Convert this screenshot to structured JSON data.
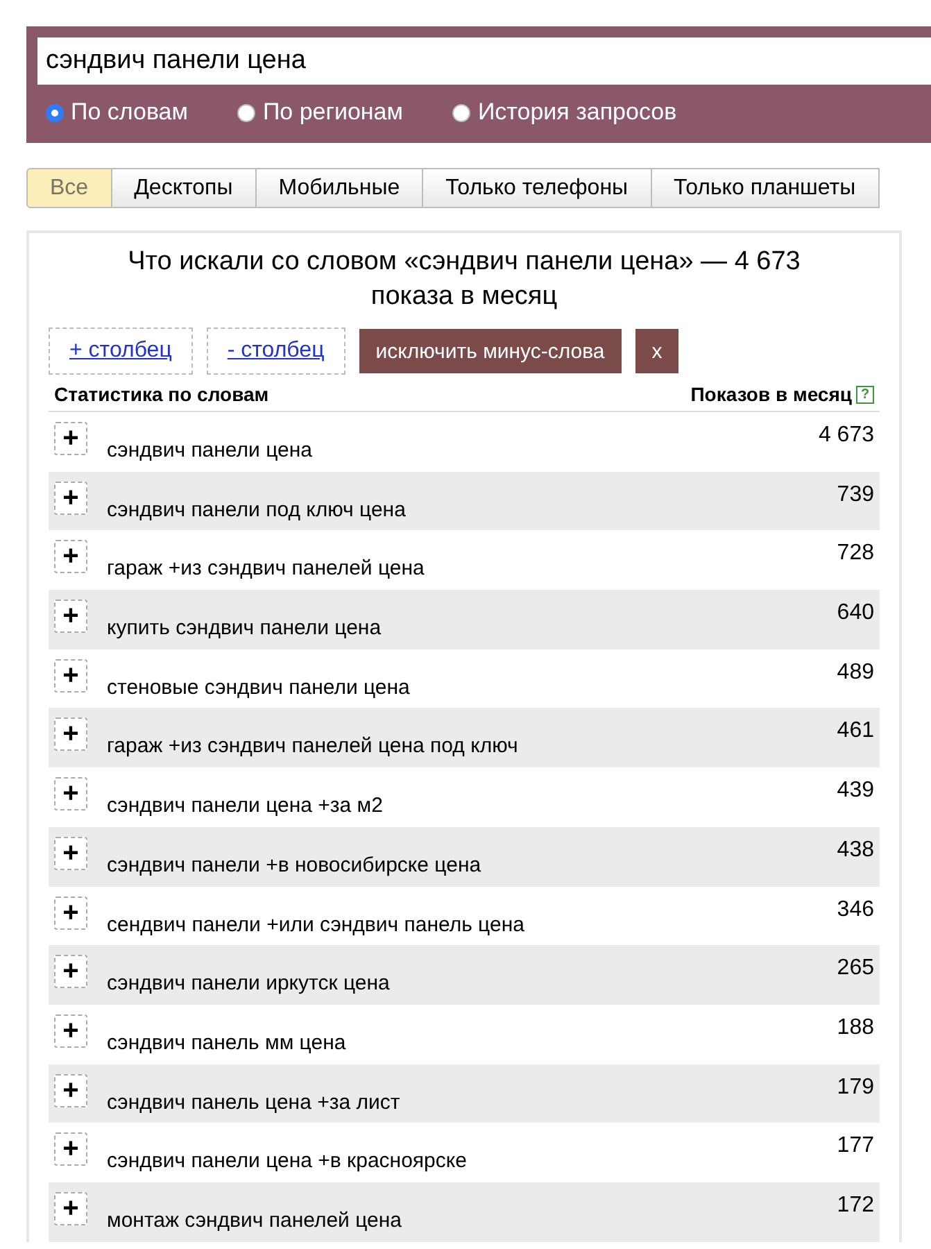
{
  "search": {
    "value": "сэндвич панели цена"
  },
  "modes": [
    {
      "label": "По словам",
      "selected": true
    },
    {
      "label": "По регионам",
      "selected": false
    },
    {
      "label": "История запросов",
      "selected": false
    }
  ],
  "tabs": [
    {
      "label": "Все",
      "selected": true
    },
    {
      "label": "Десктопы",
      "selected": false
    },
    {
      "label": "Мобильные",
      "selected": false
    },
    {
      "label": "Только телефоны",
      "selected": false
    },
    {
      "label": "Только планшеты",
      "selected": false
    }
  ],
  "panel": {
    "title": "Что искали со словом «сэндвич панели цена» — 4 673 показа в месяц",
    "add_column": "+ столбец",
    "remove_column": "- столбец",
    "exclude_button": "исключить минус-слова",
    "close_button": "x",
    "columns": {
      "phrase": "Статистика по словам",
      "count": "Показов в месяц",
      "help": "?"
    },
    "rows": [
      {
        "button": "+",
        "phrase": "сэндвич панели цена",
        "count": "4 673"
      },
      {
        "button": "+",
        "phrase": "сэндвич панели под ключ цена",
        "count": "739"
      },
      {
        "button": "+",
        "phrase": "гараж +из сэндвич панелей цена",
        "count": "728"
      },
      {
        "button": "+",
        "phrase": "купить сэндвич панели цена",
        "count": "640"
      },
      {
        "button": "+",
        "phrase": "стеновые сэндвич панели цена",
        "count": "489"
      },
      {
        "button": "+",
        "phrase": "гараж +из сэндвич панелей цена под ключ",
        "count": "461"
      },
      {
        "button": "+",
        "phrase": "сэндвич панели цена +за м2",
        "count": "439"
      },
      {
        "button": "+",
        "phrase": "сэндвич панели +в новосибирске цена",
        "count": "438"
      },
      {
        "button": "+",
        "phrase": "сендвич панели +или сэндвич панель цена",
        "count": "346"
      },
      {
        "button": "+",
        "phrase": "сэндвич панели иркутск цена",
        "count": "265"
      },
      {
        "button": "+",
        "phrase": "сэндвич панель мм цена",
        "count": "188"
      },
      {
        "button": "+",
        "phrase": "сэндвич панель цена +за лист",
        "count": "179"
      },
      {
        "button": "+",
        "phrase": "сэндвич панели цена +в красноярске",
        "count": "177"
      },
      {
        "button": "+",
        "phrase": "монтаж сэндвич панелей цена",
        "count": "172"
      }
    ]
  }
}
